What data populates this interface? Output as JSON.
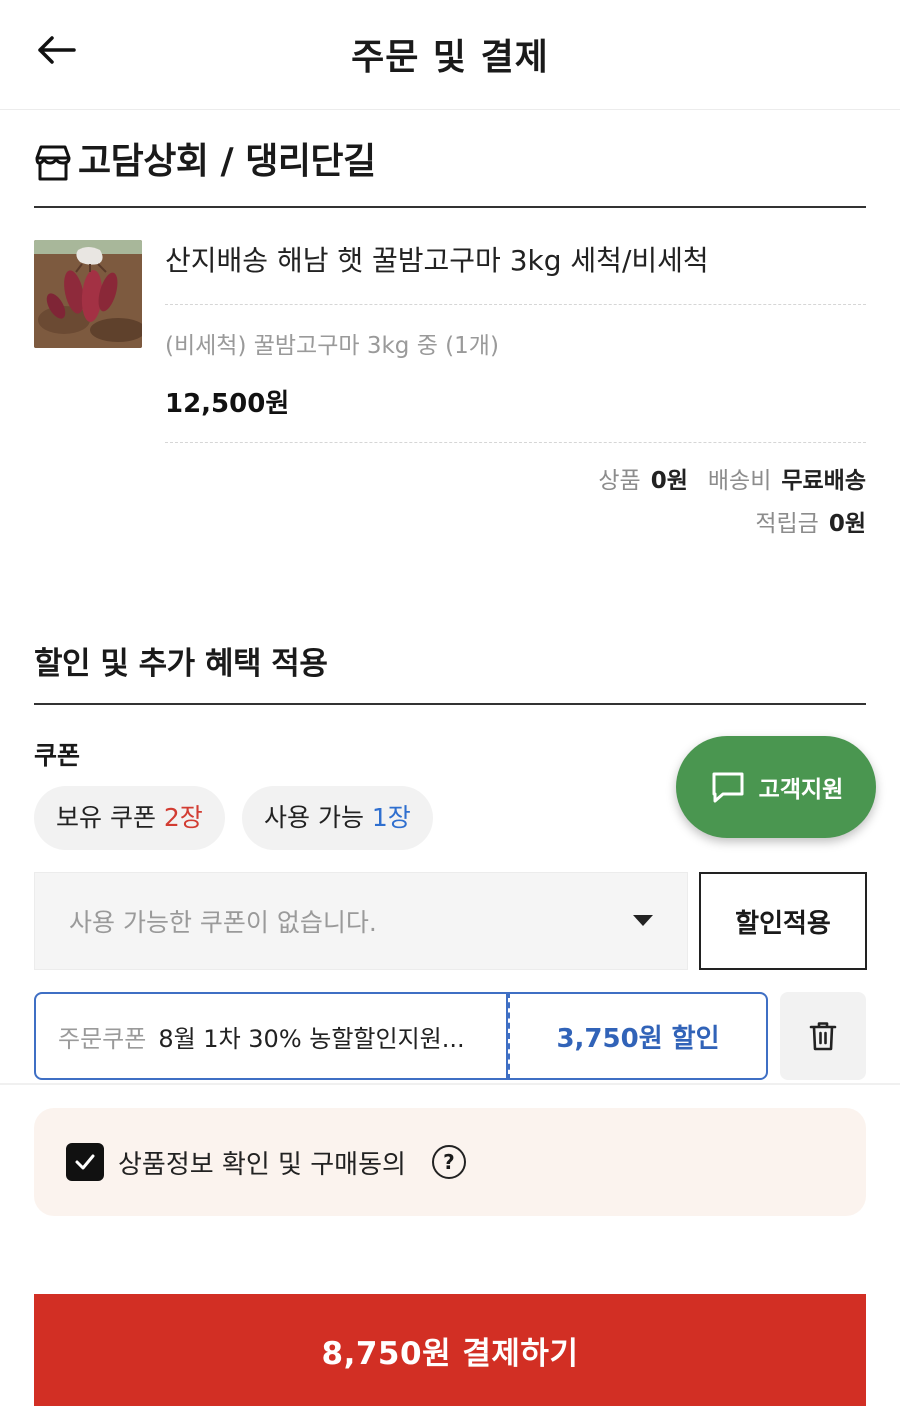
{
  "header": {
    "title": "주문 및 결제",
    "back_icon": "arrow-left-icon"
  },
  "store": {
    "icon": "store-icon",
    "name": "고담상회 / 댕리단길"
  },
  "product": {
    "image": "sweet-potato-photo",
    "name": "산지배송 해남 햇 꿀밤고구마 3kg 세척/비세척",
    "option": "(비세척) 꿀밤고구마 3kg 중 (1개)",
    "price": "12,500원"
  },
  "summary": {
    "product_label": "상품",
    "product_value": "0원",
    "shipping_label": "배송비",
    "shipping_value": "무료배송",
    "points_label": "적립금",
    "points_value": "0원"
  },
  "discount_section": {
    "title": "할인 및 추가 혜택 적용",
    "coupon_label": "쿠폰",
    "owned_prefix": "보유 쿠폰",
    "owned_count": "2장",
    "usable_prefix": "사용 가능",
    "usable_count": "1장",
    "select_placeholder": "사용 가능한 쿠폰이 없습니다.",
    "apply_label": "할인적용",
    "applied_tag": "주문쿠폰",
    "applied_name": "8월 1차 30% 농할할인지원...",
    "applied_discount": "3,750원 할인",
    "delete_icon": "trash-icon"
  },
  "support": {
    "label": "고객지원",
    "icon": "chat-bubble-icon"
  },
  "agreement": {
    "checked": true,
    "label": "상품정보 확인 및 구매동의",
    "help_icon": "question-circle-icon",
    "help_glyph": "?"
  },
  "pay_button": {
    "label": "8,750원 결제하기"
  },
  "colors": {
    "accent_red": "#d22f24",
    "accent_blue": "#3163b8",
    "support_green": "#4a9650",
    "agree_bg": "#fbf3ee"
  }
}
